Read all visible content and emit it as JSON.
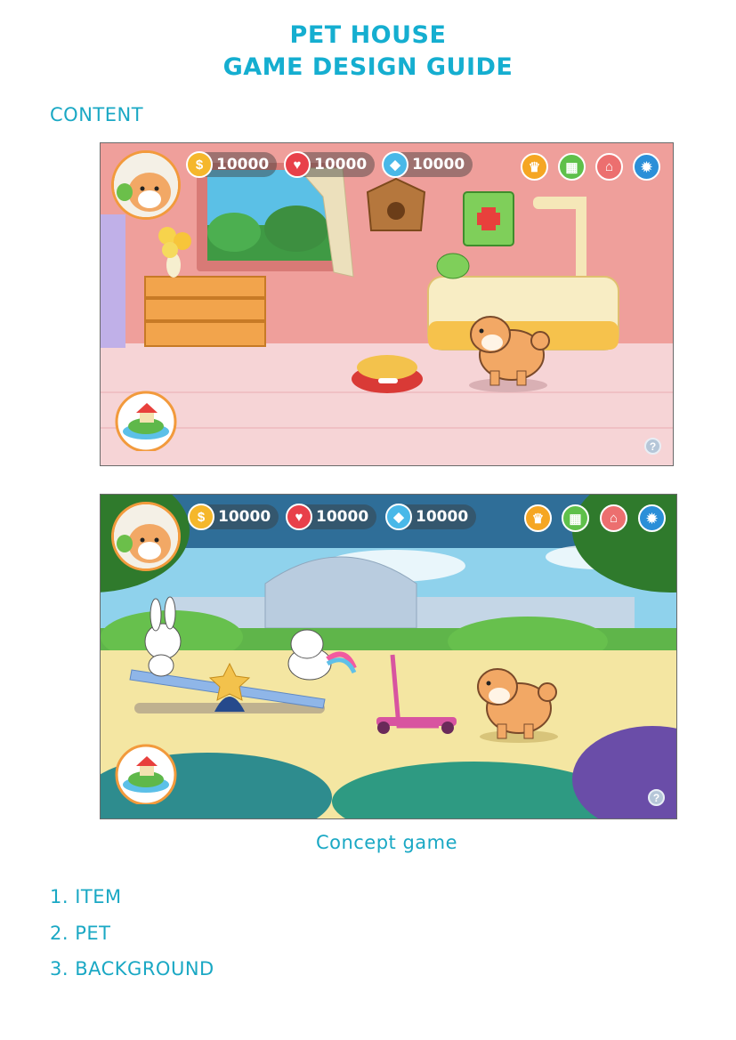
{
  "header": {
    "title_line1": "PET HOUSE",
    "title_line2": "GAME DESIGN GUIDE"
  },
  "section_label": "CONTENT",
  "screens": [
    {
      "coins": "10000",
      "hearts": "10000",
      "gems": "10000"
    },
    {
      "coins": "10000",
      "hearts": "10000",
      "gems": "10000"
    }
  ],
  "icons": {
    "coin": "coin-icon",
    "heart": "heart-icon",
    "gem": "diamond-icon",
    "trophy": "trophy-icon",
    "calendar": "calendar-icon",
    "shop": "shop-basket-icon",
    "settings": "gear-icon",
    "help": "help-icon"
  },
  "glyphs": {
    "coin": "$",
    "heart": "♥",
    "gem": "◆",
    "trophy": "♛",
    "calendar": "▦",
    "shop": "⌂",
    "settings": "✹",
    "help": "?"
  },
  "caption": "Concept game",
  "toc": [
    "1. ITEM",
    "2. PET",
    "3. BACKGROUND"
  ],
  "colors": {
    "accent": "#15aed0",
    "room_wall": "#f0a0a0",
    "room_floor": "#f7d3d6",
    "park_sky": "#2d6e9c",
    "park_ground": "#f4e6a2"
  }
}
